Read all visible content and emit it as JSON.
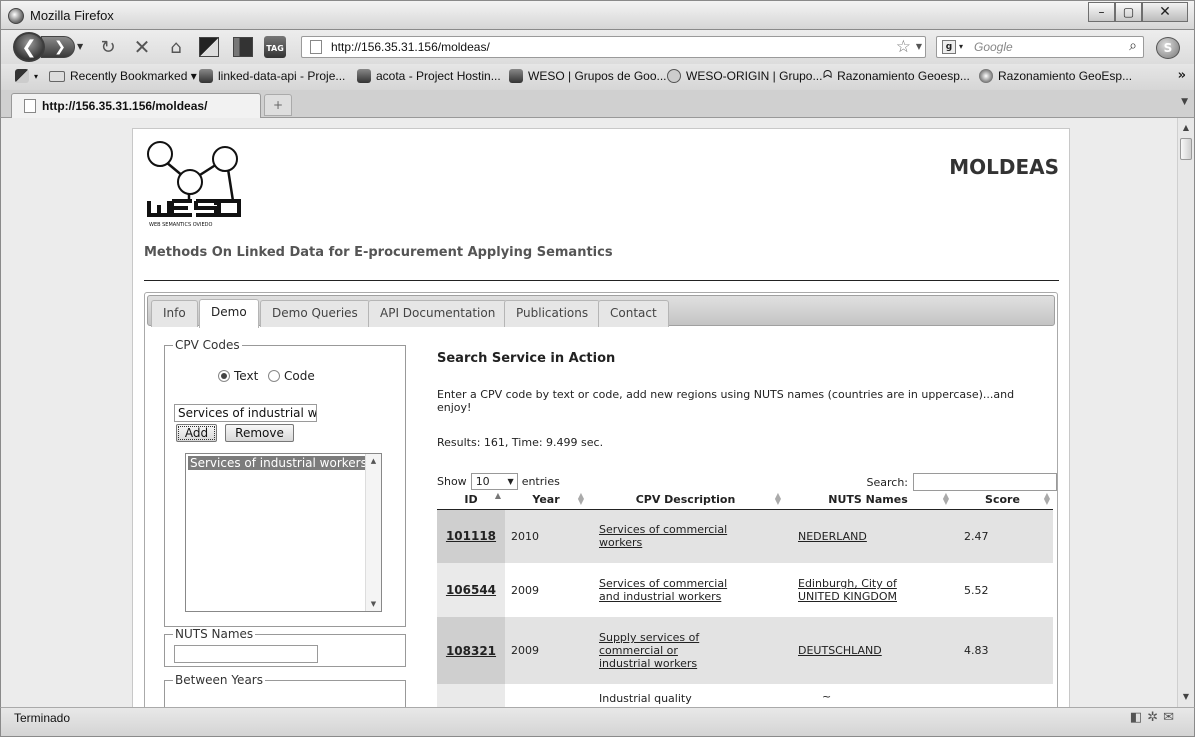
{
  "window": {
    "title": "Mozilla Firefox"
  },
  "nav": {
    "back_glyph": "❮",
    "forward_glyph": "❯",
    "url": "http://156.35.31.156/moldeas/",
    "search_placeholder": "Google"
  },
  "bookmarks": [
    {
      "label": "Recently Bookmarked ▾",
      "icon": "bookmark-folder-icon"
    },
    {
      "label": "linked-data-api - Proje...",
      "icon": "project-hosting-icon"
    },
    {
      "label": "acota - Project Hostin...",
      "icon": "project-hosting-icon"
    },
    {
      "label": "WESO | Grupos de Goo...",
      "icon": "project-hosting-icon"
    },
    {
      "label": "WESO-ORIGIN | Grupo...",
      "icon": "group-icon"
    },
    {
      "label": "Razonamiento Geoesp...",
      "icon": "geo-icon"
    },
    {
      "label": "Razonamiento GeoEsp...",
      "icon": "geo-icon"
    }
  ],
  "tab": {
    "label": "http://156.35.31.156/moldeas/"
  },
  "page": {
    "site_title": "MOLDEAS",
    "subtitle": "Methods On Linked Data for E-procurement Applying Semantics",
    "logo_caption": "WEB SEMANTICS OVIEDO",
    "tabs": [
      "Info",
      "Demo",
      "Demo Queries",
      "API Documentation",
      "Publications",
      "Contact"
    ],
    "active_tab": "Demo"
  },
  "cpv": {
    "legend": "CPV Codes",
    "radio_text": "Text",
    "radio_code": "Code",
    "selected_radio": "Text",
    "input_value": "Services of industrial wo",
    "add_label": "Add",
    "remove_label": "Remove",
    "list_items": [
      "Services of industrial workers"
    ]
  },
  "nuts": {
    "legend": "NUTS Names"
  },
  "years": {
    "legend": "Between Years"
  },
  "results": {
    "title": "Search Service in Action",
    "description": "Enter a CPV code by text or code, add new regions using NUTS names (countries are in uppercase)...and enjoy!",
    "summary": "Results: 161, Time: 9.499 sec.",
    "show_label": "Show",
    "show_value": "10",
    "entries_label": "entries",
    "search_label": "Search:",
    "columns": [
      "ID",
      "Year",
      "CPV Description",
      "NUTS Names",
      "Score"
    ],
    "rows": [
      {
        "id": "101118",
        "year": "2010",
        "cpv": "Services of commercial workers",
        "nuts": "NEDERLAND",
        "score": "2.47"
      },
      {
        "id": "106544",
        "year": "2009",
        "cpv": "Services of commercial and industrial workers",
        "nuts": "Edinburgh, City of UNITED KINGDOM",
        "score": "5.52"
      },
      {
        "id": "108321",
        "year": "2009",
        "cpv": "Supply services of commercial or industrial workers",
        "nuts": "DEUTSCHLAND",
        "score": "4.83"
      },
      {
        "id": "",
        "year": "",
        "cpv": "Industrial quality",
        "nuts": "~",
        "score": ""
      }
    ]
  },
  "status": {
    "text": "Terminado"
  }
}
